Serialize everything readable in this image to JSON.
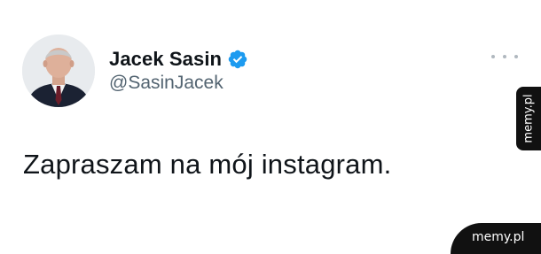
{
  "tweet": {
    "author": {
      "display_name": "Jacek Sasin",
      "handle": "@SasinJacek",
      "verified": true,
      "avatar_icon": "person-photo-avatar"
    },
    "text": "Zapraszam na mój instagram.",
    "more_icon": "more-dots-icon"
  },
  "watermarks": {
    "side": "memy.pl",
    "bottom": "memy.pl"
  },
  "colors": {
    "verified_badge": "#1d9bf0",
    "handle_text": "#536471",
    "primary_text": "#0f1419"
  }
}
